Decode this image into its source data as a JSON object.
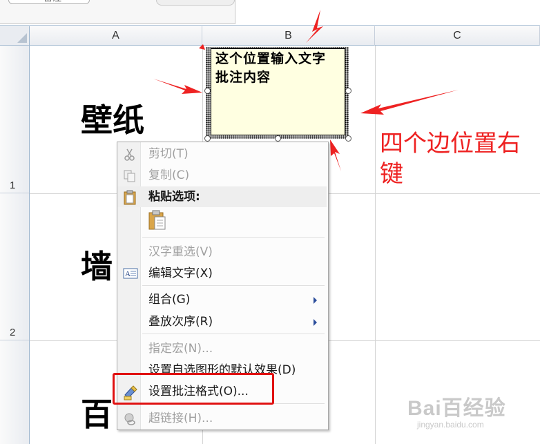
{
  "top": {
    "sheet_tab_label": "备注"
  },
  "columns": [
    "A",
    "B",
    "C"
  ],
  "rows": [
    "1",
    "2"
  ],
  "cells": {
    "a1": "壁纸",
    "a2": "墙",
    "a3": "百"
  },
  "comment": {
    "line1": "这个位置输入文字",
    "line2": "批注内容"
  },
  "annotation": {
    "text": "四个边位置右键"
  },
  "context_menu": {
    "cut": "剪切(T)",
    "copy": "复制(C)",
    "paste_options": "粘贴选项:",
    "reconvert": "汉字重选(V)",
    "edit_text": "编辑文字(X)",
    "group": "组合(G)",
    "order": "叠放次序(R)",
    "assign_macro": "指定宏(N)...",
    "set_default_effect": "设置自选图形的默认效果(D)",
    "format_comment": "设置批注格式(O)...",
    "hyperlink": "超链接(H)..."
  },
  "watermark": {
    "brand": "Bai百经验",
    "url": "jingyan.baidu.com"
  },
  "colors": {
    "annotation_red": "#ee2222",
    "comment_fill": "#ffffe1",
    "highlight_box": "#e01010"
  }
}
